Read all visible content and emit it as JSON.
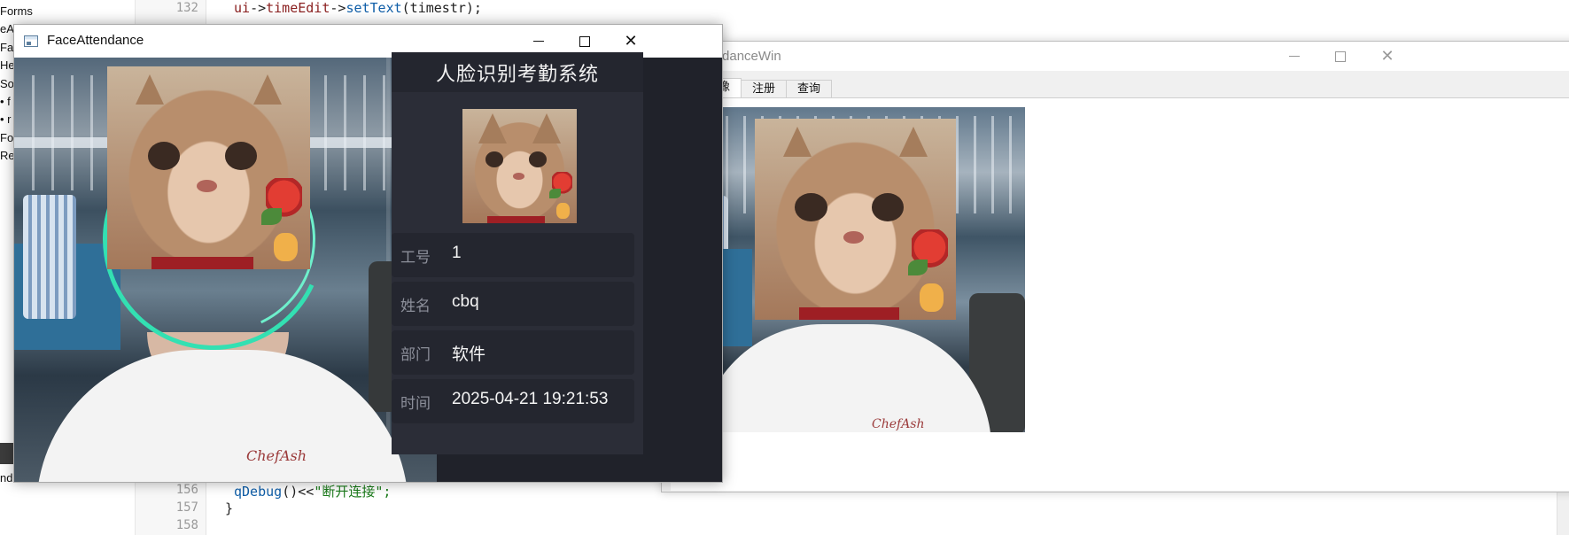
{
  "ide": {
    "tree_items": [
      "Forms",
      "eA",
      "Fac",
      "He",
      "Sou",
      "• f",
      "• r",
      "For",
      "Res",
      "nd"
    ],
    "line_numbers": [
      "132",
      "156",
      "157",
      "158"
    ],
    "code_line_132": {
      "obj": "ui",
      "op1": "->",
      "member": "timeEdit",
      "op2": "->",
      "func": "setText",
      "arg": "(timestr);"
    },
    "code_line_156": {
      "func": "qDebug",
      "rest": "()<<",
      "str": "\"断开连接\";"
    },
    "code_line_157": "}",
    "code_fragment": "r-"
  },
  "face_window": {
    "title": "FaceAttendance",
    "icon": "window-app-icon",
    "panel_title": "人脸识别考勤系统",
    "fields": [
      {
        "label": "工号",
        "value": "1"
      },
      {
        "label": "姓名",
        "value": "cbq"
      },
      {
        "label": "部门",
        "value": "软件"
      },
      {
        "label": "时间",
        "value": "2025-04-21 19:21:53"
      }
    ],
    "ring_color": "#33e0b2",
    "shirt_logo": "ChefAsh"
  },
  "attendance_window": {
    "title": "AttendanceWin",
    "tabs": [
      {
        "label": "考勤图像",
        "active": true
      },
      {
        "label": "注册",
        "active": false
      },
      {
        "label": "查询",
        "active": false
      }
    ],
    "shirt_logo": "ChefAsh"
  },
  "colors": {
    "panel_bg": "#2b2d37",
    "row_bg": "#24262f",
    "accent_ring": "#33e0b2"
  }
}
